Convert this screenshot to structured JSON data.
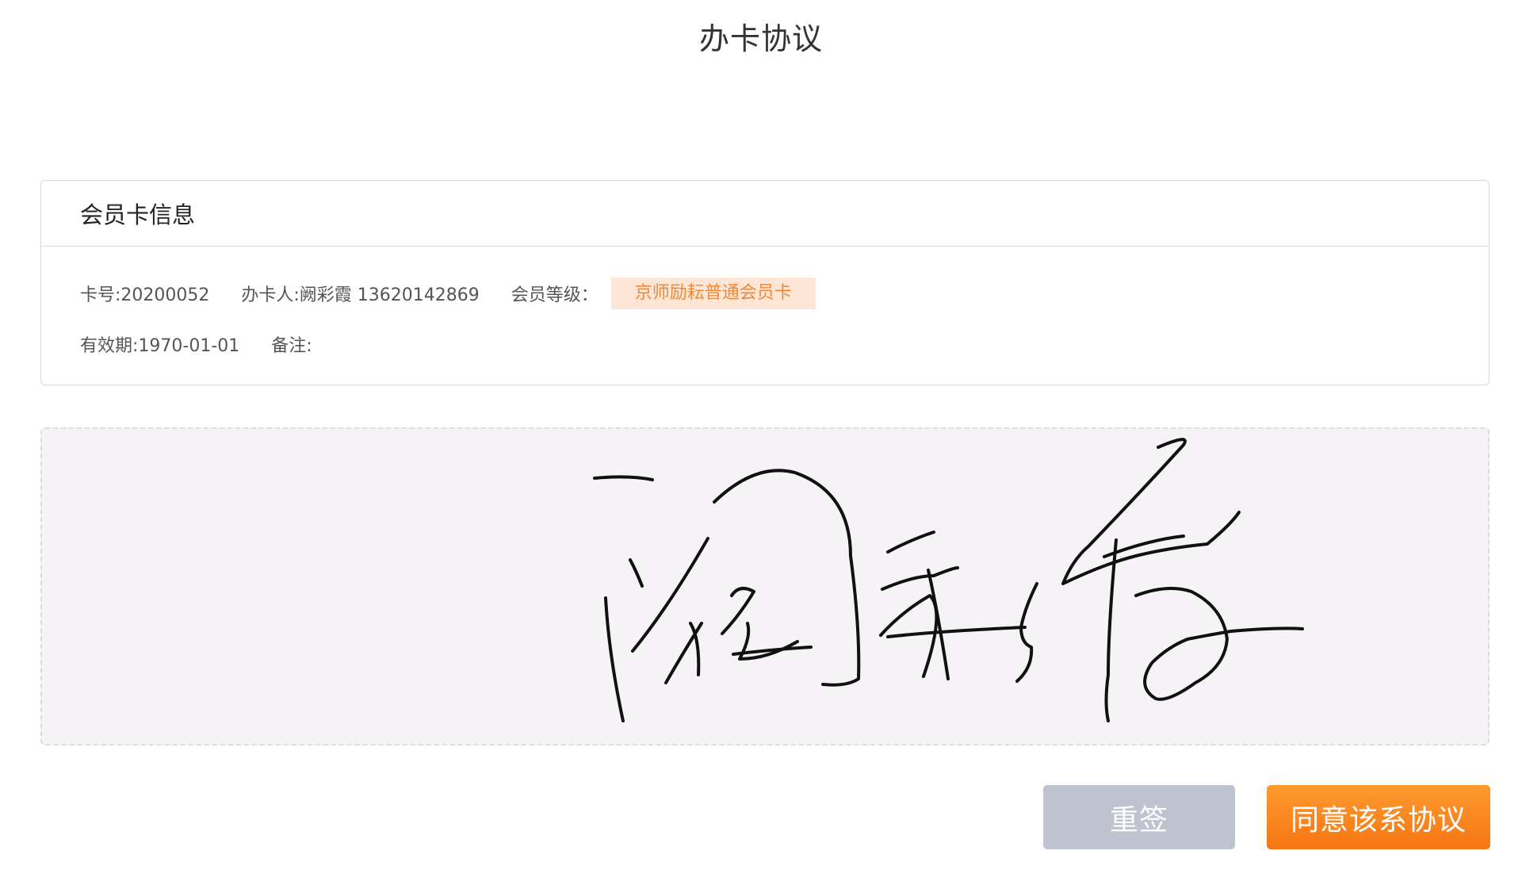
{
  "header": {
    "title": "办卡协议"
  },
  "card": {
    "title": "会员卡信息",
    "card_number": "卡号:20200052",
    "holder": "办卡人:阙彩霞 13620142869",
    "level_label": "会员等级：",
    "level_value": "京师励耘普通会员卡",
    "validity": "有效期:1970-01-01",
    "remark": "备注:"
  },
  "signature": {
    "handwriting": "阙彩霞"
  },
  "actions": {
    "resign_label": "重签",
    "agree_label": "同意该系协议"
  },
  "colors": {
    "accent": "#f57612",
    "badge_bg": "#fde6d6",
    "badge_text": "#f0883a",
    "resign_bg": "#bfc3cf",
    "sign_bg": "#f5f3f5"
  }
}
